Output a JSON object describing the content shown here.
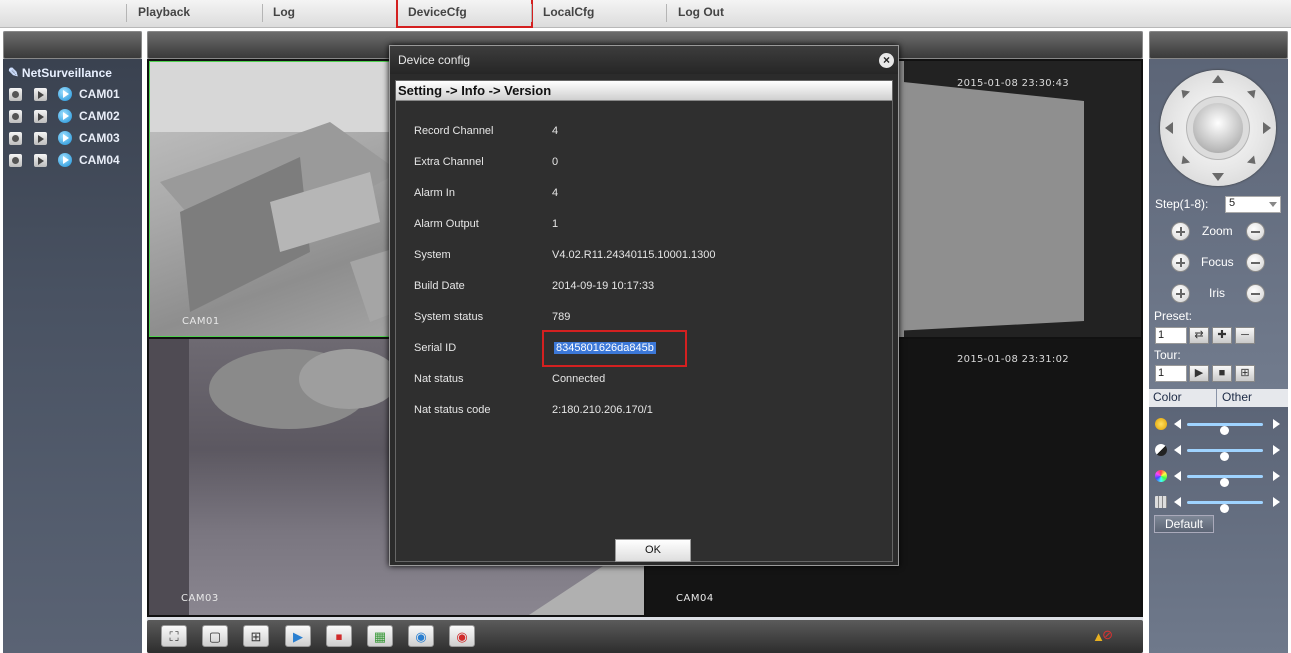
{
  "menu": {
    "items": [
      {
        "label": "Playback"
      },
      {
        "label": "Log"
      },
      {
        "label": "DeviceCfg"
      },
      {
        "label": "LocalCfg"
      },
      {
        "label": "Log Out"
      }
    ],
    "active": "DeviceCfg"
  },
  "tree": {
    "root_label": "NetSurveillance",
    "cameras": [
      {
        "label": "CAM01"
      },
      {
        "label": "CAM02"
      },
      {
        "label": "CAM03"
      },
      {
        "label": "CAM04"
      }
    ]
  },
  "video": {
    "tiles": [
      {
        "label": "CAM01",
        "timestamp": ""
      },
      {
        "label": "",
        "timestamp": "2015-01-08 23:30:43"
      },
      {
        "label": "CAM03",
        "timestamp": ""
      },
      {
        "label": "CAM04",
        "timestamp": "2015-01-08 23:31:02"
      }
    ]
  },
  "ptz": {
    "step_label": "Step(1-8):",
    "step_value": "5",
    "zoom_label": "Zoom",
    "focus_label": "Focus",
    "iris_label": "Iris",
    "preset_label": "Preset:",
    "preset_value": "1",
    "tour_label": "Tour:",
    "tour_value": "1"
  },
  "color_panel": {
    "tabs": [
      {
        "label": "Color"
      },
      {
        "label": "Other"
      }
    ],
    "sliders": [
      {
        "icon": "brightness-icon",
        "value": 0.5
      },
      {
        "icon": "contrast-icon",
        "value": 0.5
      },
      {
        "icon": "saturation-icon",
        "value": 0.5
      },
      {
        "icon": "hue-icon",
        "value": 0.5
      }
    ],
    "default_label": "Default"
  },
  "dialog": {
    "title": "Device config",
    "breadcrumb": "Setting -> Info -> Version",
    "rows": [
      {
        "label": "Record Channel",
        "value": "4"
      },
      {
        "label": "Extra Channel",
        "value": "0"
      },
      {
        "label": "Alarm In",
        "value": "4"
      },
      {
        "label": "Alarm Output",
        "value": "1"
      },
      {
        "label": "System",
        "value": "V4.02.R11.24340115.10001.1300"
      },
      {
        "label": "Build Date",
        "value": "2014-09-19 10:17:33"
      },
      {
        "label": "System status",
        "value": "789"
      },
      {
        "label": "Serial ID",
        "value": "8345801626da845b"
      },
      {
        "label": "Nat status",
        "value": "Connected"
      },
      {
        "label": "Nat status code",
        "value": "2:180.210.206.170/1"
      }
    ],
    "ok_label": "OK"
  },
  "colors": {
    "highlight_box": "#d42020",
    "selection": "#3c78d8",
    "active_tile_border": "#4fd04f"
  }
}
